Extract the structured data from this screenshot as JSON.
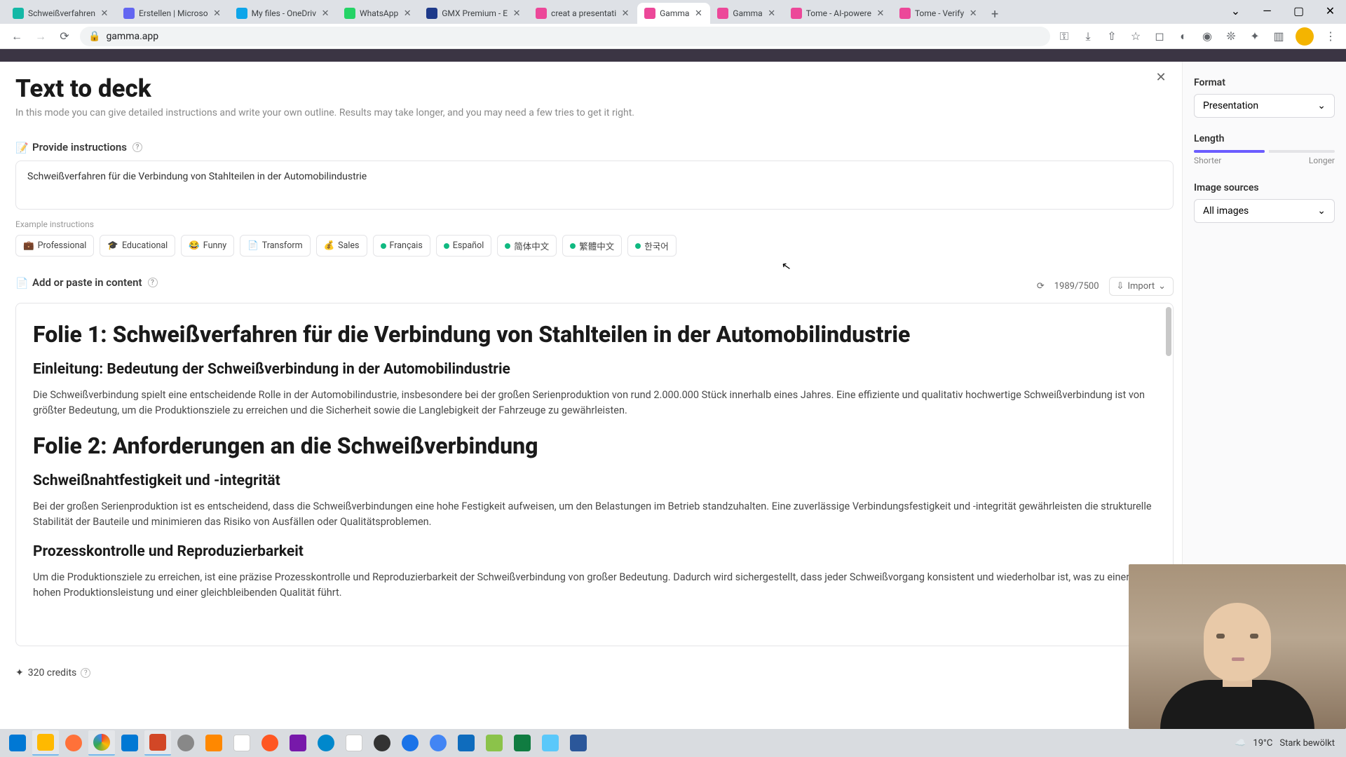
{
  "browser": {
    "tabs": [
      {
        "title": "Schweißverfahren",
        "fav": "#14b8a6"
      },
      {
        "title": "Erstellen | Microso",
        "fav": "#6366f1"
      },
      {
        "title": "My files - OneDriv",
        "fav": "#0ea5e9"
      },
      {
        "title": "WhatsApp",
        "fav": "#25d366"
      },
      {
        "title": "GMX Premium - E",
        "fav": "#1e3a8a"
      },
      {
        "title": "creat a presentati",
        "fav": "#ec4899"
      },
      {
        "title": "Gamma",
        "fav": "#ec4899",
        "active": true
      },
      {
        "title": "Gamma",
        "fav": "#ec4899"
      },
      {
        "title": "Tome - AI-powere",
        "fav": "#ec4899"
      },
      {
        "title": "Tome - Verify",
        "fav": "#ec4899"
      }
    ],
    "url": "gamma.app"
  },
  "page": {
    "title": "Text to deck",
    "subtitle": "In this mode you can give detailed instructions and write your own outline. Results may take longer, and you may need a few tries to get it right."
  },
  "instructions": {
    "heading": "Provide instructions",
    "value": "Schweißverfahren für die Verbindung von Stahlteilen in der Automobilindustrie",
    "examples_label": "Example instructions",
    "chips": [
      {
        "emoji": "💼",
        "label": "Professional"
      },
      {
        "emoji": "🎓",
        "label": "Educational"
      },
      {
        "emoji": "😂",
        "label": "Funny"
      },
      {
        "emoji": "📄",
        "label": "Transform"
      },
      {
        "emoji": "💰",
        "label": "Sales"
      },
      {
        "dot": true,
        "label": "Français"
      },
      {
        "dot": true,
        "label": "Español"
      },
      {
        "dot": true,
        "label": "简体中文"
      },
      {
        "dot": true,
        "label": "繁體中文"
      },
      {
        "dot": true,
        "label": "한국어"
      }
    ]
  },
  "content": {
    "heading": "Add or paste in content",
    "counter": "1989/7500",
    "import_label": "Import",
    "body": {
      "h1a": "Folie 1: Schweißverfahren für die Verbindung von Stahlteilen in der Automobilindustrie",
      "h2a": "Einleitung: Bedeutung der Schweißverbindung in der Automobilindustrie",
      "p1": "Die Schweißverbindung spielt eine entscheidende Rolle in der Automobilindustrie, insbesondere bei der großen Serienproduktion von rund 2.000.000 Stück innerhalb eines Jahres. Eine effiziente und qualitativ hochwertige Schweißverbindung ist von größter Bedeutung, um die Produktionsziele zu erreichen und die Sicherheit sowie die Langlebigkeit der Fahrzeuge zu gewährleisten.",
      "h1b": "Folie 2: Anforderungen an die Schweißverbindung",
      "h2b": "Schweißnahtfestigkeit und -integrität",
      "p2": "Bei der großen Serienproduktion ist es entscheidend, dass die Schweißverbindungen eine hohe Festigkeit aufweisen, um den Belastungen im Betrieb standzuhalten. Eine zuverlässige Verbindungsfestigkeit und -integrität gewährleisten die strukturelle Stabilität der Bauteile und minimieren das Risiko von Ausfällen oder Qualitätsproblemen.",
      "h2c": "Prozesskontrolle und Reproduzierbarkeit",
      "p3": "Um die Produktionsziele zu erreichen, ist eine präzise Prozesskontrolle und Reproduzierbarkeit der Schweißverbindung von großer Bedeutung. Dadurch wird sichergestellt, dass jeder Schweißvorgang konsistent und wiederholbar ist, was zu einer hohen Produktionsleistung und einer gleichbleibenden Qualität führt."
    }
  },
  "sidebar": {
    "format_label": "Format",
    "format_value": "Presentation",
    "length_label": "Length",
    "length_shorter": "Shorter",
    "length_longer": "Longer",
    "images_label": "Image sources",
    "images_value": "All images"
  },
  "footer": {
    "credits": "320 credits"
  },
  "system": {
    "temp": "19°C",
    "weather": "Stark bewölkt"
  }
}
